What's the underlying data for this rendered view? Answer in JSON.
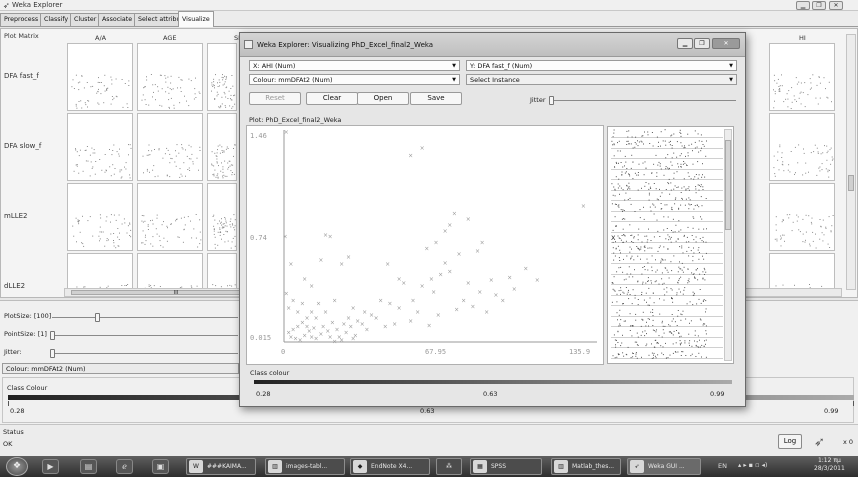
{
  "window": {
    "title": "Weka Explorer",
    "icon": "weka-bird-icon"
  },
  "tabs": [
    "Preprocess",
    "Classify",
    "Cluster",
    "Associate",
    "Select attributes",
    "Visualize"
  ],
  "active_tab": "Visualize",
  "matrix": {
    "label": "Plot Matrix",
    "columns": [
      "A/A",
      "AGE",
      "SI",
      "HI"
    ],
    "rows": [
      "DFA fast_f",
      "DFA slow_f",
      "mLLE2",
      "dLLE2"
    ],
    "scrollbar_thumb_label": "III"
  },
  "controls": {
    "plotsize_label": "PlotSize: [100]",
    "pointsize_label": "PointSize: [1]",
    "jitter_label": "Jitter:",
    "colour_combo": "Colour: mmDFAt2 (Num)",
    "class_colour_label": "Class Colour",
    "class_min": "0.28",
    "class_mid": "0.63",
    "class_max": "0.99"
  },
  "status": {
    "label": "Status",
    "value": "OK",
    "log_button": "Log",
    "x_count": "x 0"
  },
  "dialog": {
    "title": "Weka Explorer: Visualizing PhD_Excel_final2_Weka",
    "x_combo": "X: AHI (Num)",
    "y_combo": "Y: DFA fast_f (Num)",
    "colour_combo": "Colour: mmDFAt2 (Num)",
    "select_combo": "Select Instance",
    "buttons": {
      "reset": "Reset",
      "clear": "Clear",
      "open": "Open",
      "save": "Save"
    },
    "jitter_label": "Jitter",
    "plot_label": "Plot: PhD_Excel_final2_Weka",
    "class_colour_label": "Class colour",
    "class_min": "0.28",
    "class_mid": "0.63",
    "class_max": "0.99",
    "side_x_label": "X"
  },
  "chart_data": {
    "type": "scatter",
    "x_ticks": [
      "0",
      "67.95",
      "135.9"
    ],
    "y_ticks": [
      "1.46",
      "0.74",
      "0.015"
    ],
    "xlim": [
      0,
      135.9
    ],
    "ylim": [
      0.015,
      1.46
    ],
    "marker": "×",
    "color": "#9a9a9a",
    "points": [
      [
        1,
        1.46
      ],
      [
        0.5,
        0.74
      ],
      [
        3,
        0.55
      ],
      [
        55,
        1.3
      ],
      [
        60,
        1.35
      ],
      [
        130,
        0.95
      ],
      [
        70,
        0.78
      ],
      [
        72,
        0.82
      ],
      [
        80,
        0.86
      ],
      [
        74,
        0.9
      ],
      [
        66,
        0.7
      ],
      [
        62,
        0.66
      ],
      [
        18,
        0.75
      ],
      [
        20,
        0.74
      ],
      [
        25,
        0.55
      ],
      [
        28,
        0.6
      ],
      [
        45,
        0.55
      ],
      [
        50,
        0.45
      ],
      [
        52,
        0.42
      ],
      [
        60,
        0.4
      ],
      [
        65,
        0.36
      ],
      [
        68,
        0.48
      ],
      [
        72,
        0.5
      ],
      [
        80,
        0.42
      ],
      [
        85,
        0.36
      ],
      [
        90,
        0.44
      ],
      [
        95,
        0.3
      ],
      [
        100,
        0.38
      ],
      [
        42,
        0.3
      ],
      [
        46,
        0.28
      ],
      [
        38,
        0.2
      ],
      [
        40,
        0.18
      ],
      [
        35,
        0.22
      ],
      [
        30,
        0.25
      ],
      [
        28,
        0.18
      ],
      [
        26,
        0.14
      ],
      [
        22,
        0.3
      ],
      [
        15,
        0.28
      ],
      [
        12,
        0.22
      ],
      [
        10,
        0.18
      ],
      [
        8,
        0.15
      ],
      [
        6,
        0.12
      ],
      [
        4,
        0.1
      ],
      [
        2,
        0.08
      ],
      [
        3,
        0.05
      ],
      [
        5,
        0.04
      ],
      [
        7,
        0.03
      ],
      [
        9,
        0.06
      ],
      [
        11,
        0.09
      ],
      [
        13,
        0.11
      ],
      [
        14,
        0.04
      ],
      [
        16,
        0.07
      ],
      [
        17,
        0.12
      ],
      [
        19,
        0.09
      ],
      [
        21,
        0.15
      ],
      [
        23,
        0.1
      ],
      [
        24,
        0.05
      ],
      [
        27,
        0.08
      ],
      [
        29,
        0.12
      ],
      [
        31,
        0.06
      ],
      [
        32,
        0.16
      ],
      [
        34,
        0.14
      ],
      [
        36,
        0.1
      ],
      [
        1,
        0.35
      ],
      [
        2,
        0.25
      ],
      [
        4,
        0.3
      ],
      [
        6,
        0.22
      ],
      [
        8,
        0.28
      ],
      [
        10,
        0.12
      ],
      [
        12,
        0.05
      ],
      [
        14,
        0.18
      ],
      [
        18,
        0.22
      ],
      [
        20,
        0.05
      ],
      [
        22,
        0.02
      ],
      [
        25,
        0.03
      ],
      [
        30,
        0.04
      ],
      [
        44,
        0.12
      ],
      [
        48,
        0.14
      ],
      [
        55,
        0.16
      ],
      [
        58,
        0.22
      ],
      [
        63,
        0.13
      ],
      [
        67,
        0.2
      ],
      [
        75,
        0.24
      ],
      [
        78,
        0.3
      ],
      [
        82,
        0.26
      ],
      [
        88,
        0.22
      ],
      [
        92,
        0.34
      ],
      [
        98,
        0.46
      ],
      [
        105,
        0.52
      ],
      [
        110,
        0.44
      ],
      [
        16,
        0.58
      ],
      [
        12,
        0.4
      ],
      [
        9,
        0.45
      ],
      [
        50,
        0.25
      ],
      [
        56,
        0.3
      ],
      [
        64,
        0.45
      ],
      [
        70,
        0.56
      ],
      [
        76,
        0.62
      ],
      [
        84,
        0.64
      ],
      [
        86,
        0.7
      ]
    ]
  }
}
